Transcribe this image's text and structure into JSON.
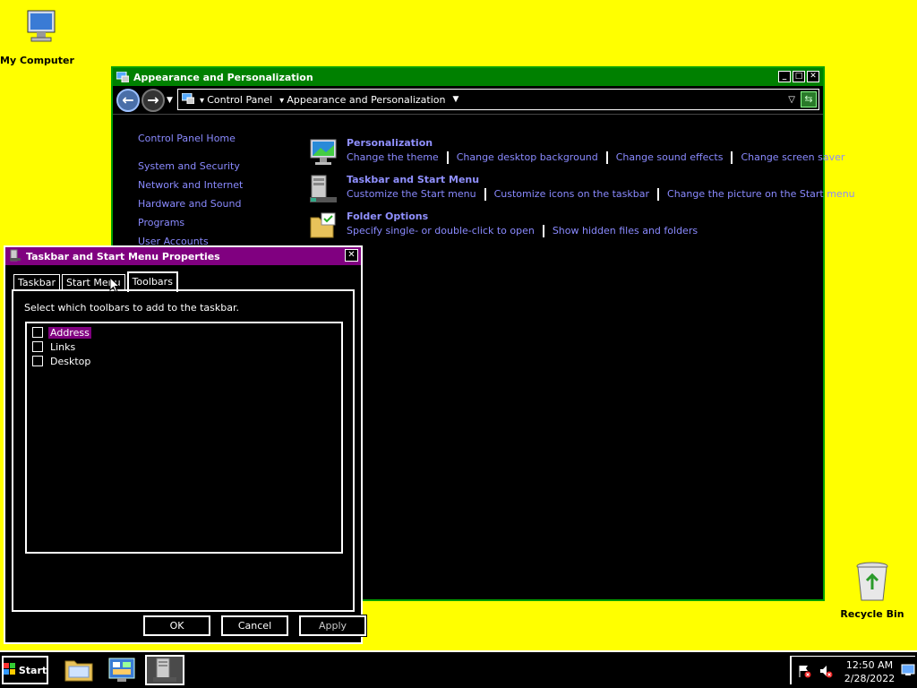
{
  "desktop": {
    "my_computer_label": "My Computer",
    "recycle_bin_label": "Recycle Bin"
  },
  "control_panel": {
    "title": "Appearance and Personalization",
    "breadcrumbs": [
      "Control Panel",
      "Appearance and Personalization"
    ],
    "left_nav": {
      "home": "Control Panel Home",
      "items": [
        "System and Security",
        "Network and Internet",
        "Hardware and Sound",
        "Programs",
        "User Accounts"
      ]
    },
    "sections": [
      {
        "title": "Personalization",
        "icon": "personalization-icon",
        "links": [
          "Change the theme",
          "Change desktop background",
          "Change sound effects",
          "Change screen saver"
        ]
      },
      {
        "title": "Taskbar and Start Menu",
        "icon": "taskbar-icon",
        "links": [
          "Customize the Start menu",
          "Customize icons on the taskbar",
          "Change the picture on the Start menu"
        ]
      },
      {
        "title": "Folder Options",
        "icon": "folder-options-icon",
        "links": [
          "Specify single- or double-click to open",
          "Show hidden files and folders"
        ]
      }
    ]
  },
  "dialog": {
    "title": "Taskbar and Start Menu Properties",
    "tabs": [
      "Taskbar",
      "Start Menu",
      "Toolbars"
    ],
    "active_tab": "Toolbars",
    "instruction": "Select which toolbars to add to the taskbar.",
    "toolbars": [
      {
        "label": "Address",
        "checked": false,
        "selected": true
      },
      {
        "label": "Links",
        "checked": false,
        "selected": false
      },
      {
        "label": "Desktop",
        "checked": false,
        "selected": false
      }
    ],
    "buttons": {
      "ok": "OK",
      "cancel": "Cancel",
      "apply": "Apply"
    },
    "close_glyph": "✕"
  },
  "taskbar": {
    "start_label": "Start",
    "clock_time": "12:50 AM",
    "clock_date": "2/28/2022"
  },
  "colors": {
    "desktop": "#ffff00",
    "cp_title": "#008000",
    "dialog_title": "#800080",
    "link": "#8a8aff",
    "selection": "#800080"
  }
}
